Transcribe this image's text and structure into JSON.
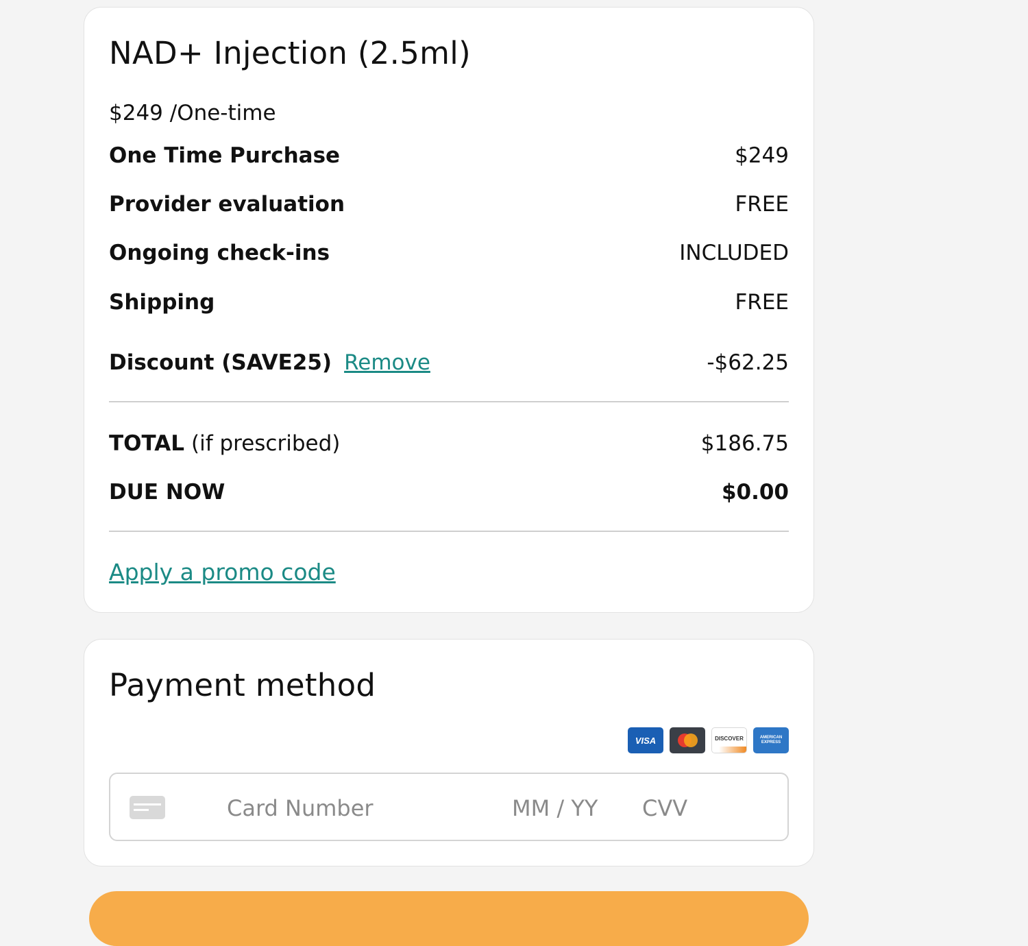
{
  "summary": {
    "product_title": "NAD+ Injection (2.5ml)",
    "price_line": "$249 /One-time",
    "line_items": [
      {
        "label": "One Time Purchase",
        "value": "$249"
      },
      {
        "label": "Provider evaluation",
        "value": "FREE"
      },
      {
        "label": "Ongoing check-ins",
        "value": "INCLUDED"
      },
      {
        "label": "Shipping",
        "value": "FREE"
      }
    ],
    "discount": {
      "label": "Discount (SAVE25)",
      "remove_label": "Remove",
      "value": "-$62.25"
    },
    "total": {
      "label": "TOTAL",
      "sublabel": "(if prescribed)",
      "value": "$186.75"
    },
    "due_now": {
      "label": "DUE NOW",
      "value": "$0.00"
    },
    "promo_link": "Apply a promo code"
  },
  "payment": {
    "title": "Payment method",
    "card_brands": [
      "visa-logo-icon",
      "mastercard-logo-icon",
      "discover-logo-icon",
      "amex-logo-icon"
    ],
    "card_brand_text": {
      "visa": "VISA",
      "discover": "DISCOVER",
      "amex": "AMERICAN EXPRESS"
    },
    "card_number_placeholder": "Card Number",
    "expiry_placeholder": "MM / YY",
    "cvv_placeholder": "CVV"
  },
  "colors": {
    "link": "#1b8a85",
    "cta": "#f7ac4a",
    "background": "#f4f4f4"
  }
}
